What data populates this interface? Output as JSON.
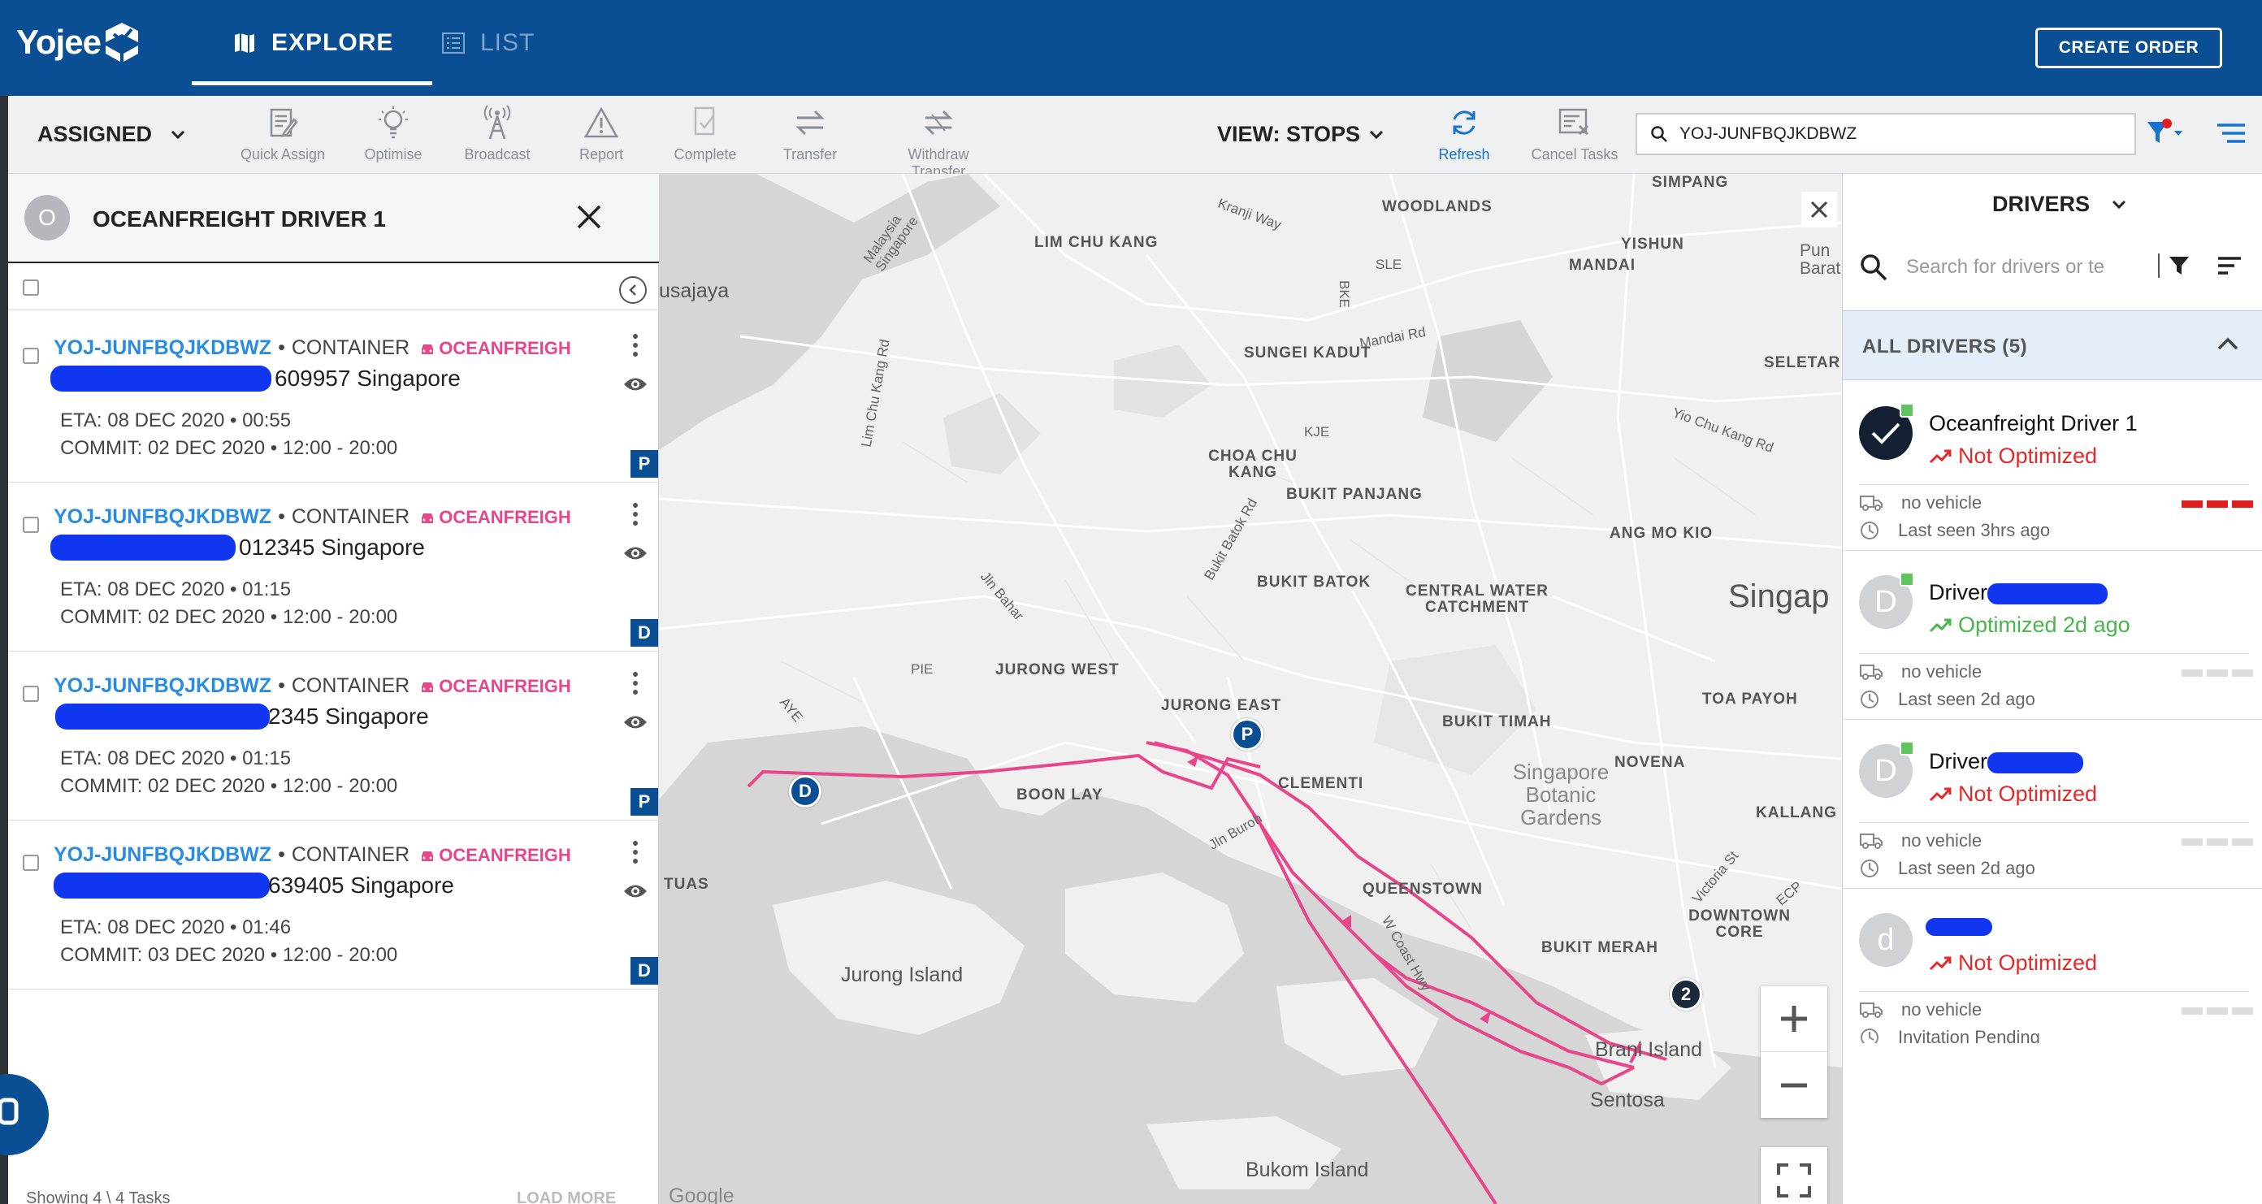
{
  "app": {
    "logo_text": "Yojee",
    "tabs": [
      {
        "label": "EXPLORE",
        "active": true
      },
      {
        "label": "LIST",
        "active": false
      }
    ],
    "create_order_label": "CREATE ORDER"
  },
  "toolbar": {
    "status_select": "ASSIGNED",
    "tools": [
      {
        "label": "Quick Assign",
        "icon": "quick-assign-icon"
      },
      {
        "label": "Optimise",
        "icon": "bulb-icon"
      },
      {
        "label": "Broadcast",
        "icon": "broadcast-icon"
      },
      {
        "label": "Report",
        "icon": "warning-icon"
      },
      {
        "label": "Complete",
        "icon": "complete-icon"
      },
      {
        "label": "Transfer",
        "icon": "transfer-icon"
      },
      {
        "label": "Withdraw Transfer",
        "icon": "withdraw-transfer-icon"
      }
    ],
    "view_select": "VIEW: STOPS",
    "refresh_label": "Refresh",
    "cancel_tasks_label": "Cancel Tasks",
    "search_value": "YOJ-JUNFBQJKDBWZ"
  },
  "driver_panel": {
    "avatar_letter": "O",
    "title": "OCEANFREIGHT DRIVER 1",
    "tasks": [
      {
        "code": "YOJ-JUNFBQJKDBWZ",
        "type": "CONTAINER",
        "tag": "OCEANFREIGH",
        "address": "609957 Singapore",
        "eta": "ETA: 08 DEC 2020 • 00:55",
        "commit": "COMMIT: 02 DEC 2020 • 12:00 - 20:00",
        "badge": "P"
      },
      {
        "code": "YOJ-JUNFBQJKDBWZ",
        "type": "CONTAINER",
        "tag": "OCEANFREIGH",
        "address": "012345 Singapore",
        "eta": "ETA: 08 DEC 2020 • 01:15",
        "commit": "COMMIT: 02 DEC 2020 • 12:00 - 20:00",
        "badge": "D"
      },
      {
        "code": "YOJ-JUNFBQJKDBWZ",
        "type": "CONTAINER",
        "tag": "OCEANFREIGH",
        "address": "2345 Singapore",
        "eta": "ETA: 08 DEC 2020 • 01:15",
        "commit": "COMMIT: 02 DEC 2020 • 12:00 - 20:00",
        "badge": "P"
      },
      {
        "code": "YOJ-JUNFBQJKDBWZ",
        "type": "CONTAINER",
        "tag": "OCEANFREIGH",
        "address": "639405 Singapore",
        "eta": "ETA: 08 DEC 2020 • 01:46",
        "commit": "COMMIT: 03 DEC 2020 • 12:00 - 20:00",
        "badge": "D"
      }
    ],
    "footer_count": "Showing 4 \\ 4 Tasks",
    "footer_load_more": "LOAD MORE"
  },
  "map": {
    "labels": [
      "SIMPANG",
      "WOODLANDS",
      "YISHUN",
      "MANDAI",
      "LIM CHU KANG",
      "SUNGEI KADUT",
      "SELETAR",
      "CHOA CHU KANG",
      "BUKIT PANJANG",
      "ANG MO KIO",
      "BUKIT BATOK",
      "CENTRAL WATER CATCHMENT",
      "JURONG WEST",
      "JURONG EAST",
      "BUKIT TIMAH",
      "TOA PAYOH",
      "NOVENA",
      "BOON LAY",
      "CLEMENTI",
      "KALLANG",
      "TUAS",
      "QUEENSTOWN",
      "DOWNTOWN CORE",
      "BUKIT MERAH"
    ],
    "big_label": "Singap",
    "islands": [
      "Jurong Island",
      "Brani Island",
      "Sentosa",
      "Bukom Island"
    ],
    "usajaya": "usajaya",
    "park": "Singapore Botanic Gardens",
    "roads": [
      "Kranji Way",
      "SLE",
      "BKE",
      "Mandai Rd",
      "KJE",
      "PIE",
      "AYE",
      "Lim Chu Kang Rd",
      "Jln Bahar",
      "Bukit Batok Rd",
      "Yio Chu Kang Rd",
      "Jln Buroh",
      "W Coast Hwy",
      "Victoria St",
      "ECP",
      "Malaysia Singapore",
      "Pun Barat"
    ],
    "markers": [
      "D",
      "P",
      "2"
    ],
    "google": "Google"
  },
  "drivers_panel": {
    "title": "DRIVERS",
    "search_placeholder": "Search for drivers or te",
    "group_label": "ALL DRIVERS (5)",
    "drivers": [
      {
        "initial": "✓",
        "name": "Oceanfreight Driver 1",
        "status": "Not Optimized",
        "vehicle": "no vehicle",
        "seen": "Last seen 3hrs ago"
      },
      {
        "initial": "D",
        "name": "Driver",
        "status": "Optimized 2d ago",
        "vehicle": "no vehicle",
        "seen": "Last seen 2d ago"
      },
      {
        "initial": "D",
        "name": "Driver",
        "status": "Not Optimized",
        "vehicle": "no vehicle",
        "seen": "Last seen 2d ago"
      },
      {
        "initial": "d",
        "name": "",
        "status": "Not Optimized",
        "vehicle": "no vehicle",
        "seen": "Invitation Pending"
      }
    ]
  },
  "colors": {
    "header": "#0a4f93",
    "accent_blue": "#2a8ce0",
    "route_pink": "#e8458b",
    "not_optimized": "#e22a2a",
    "optimized": "#49b54a"
  }
}
